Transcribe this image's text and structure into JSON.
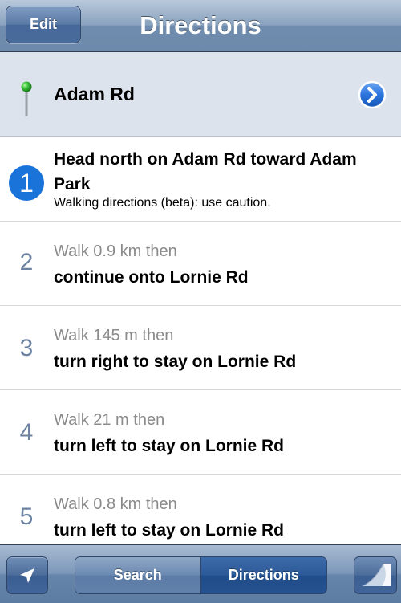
{
  "navbar": {
    "edit_label": "Edit",
    "title": "Directions"
  },
  "origin": {
    "label": "Adam Rd",
    "pin_color": "#2fb52f"
  },
  "steps": [
    {
      "number": "1",
      "title": "Head north on Adam Rd toward Adam Park",
      "note": "Walking directions (beta): use caution."
    },
    {
      "number": "2",
      "distance": "Walk 0.9 km then",
      "instruction": "continue onto Lornie Rd"
    },
    {
      "number": "3",
      "distance": "Walk 145 m then",
      "instruction": "turn right to stay on Lornie Rd"
    },
    {
      "number": "4",
      "distance": "Walk 21 m then",
      "instruction": "turn left to stay on Lornie Rd"
    },
    {
      "number": "5",
      "distance": "Walk 0.8 km then",
      "instruction": "turn left to stay on Lornie Rd"
    }
  ],
  "toolbar": {
    "locate_icon": "location-arrow-icon",
    "search_label": "Search",
    "directions_label": "Directions",
    "curl_icon": "page-curl-icon",
    "selected_segment": "Directions"
  },
  "colors": {
    "accent": "#1a73d9",
    "step_number": "#6d82a1"
  }
}
